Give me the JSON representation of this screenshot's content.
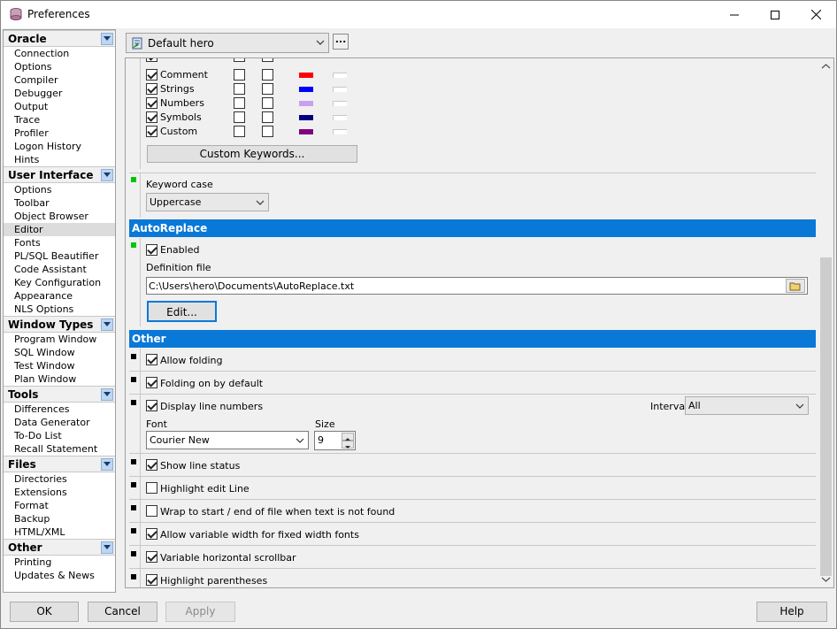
{
  "window": {
    "title": "Preferences"
  },
  "nav": [
    {
      "group": "Oracle",
      "items": [
        "Connection",
        "Options",
        "Compiler",
        "Debugger",
        "Output",
        "Trace",
        "Profiler",
        "Logon History",
        "Hints"
      ]
    },
    {
      "group": "User Interface",
      "items": [
        "Options",
        "Toolbar",
        "Object Browser",
        "Editor",
        "Fonts",
        "PL/SQL Beautifier",
        "Code Assistant",
        "Key Configuration",
        "Appearance",
        "NLS Options"
      ]
    },
    {
      "group": "Window Types",
      "items": [
        "Program Window",
        "SQL Window",
        "Test Window",
        "Plan Window"
      ]
    },
    {
      "group": "Tools",
      "items": [
        "Differences",
        "Data Generator",
        "To-Do List",
        "Recall Statement"
      ]
    },
    {
      "group": "Files",
      "items": [
        "Directories",
        "Extensions",
        "Format",
        "Backup",
        "HTML/XML"
      ]
    },
    {
      "group": "Other",
      "items": [
        "Printing",
        "Updates & News"
      ]
    }
  ],
  "selected_nav": "Editor",
  "profile": {
    "value": "Default hero",
    "more_label": "..."
  },
  "syntax_rows": [
    {
      "label": "Comment",
      "color": "#ff0000"
    },
    {
      "label": "Strings",
      "color": "#0000ff"
    },
    {
      "label": "Numbers",
      "color": "#c8a0f0"
    },
    {
      "label": "Symbols",
      "color": "#000080"
    },
    {
      "label": "Custom",
      "color": "#800080"
    }
  ],
  "custom_keywords_label": "Custom Keywords...",
  "keyword_case": {
    "label": "Keyword case",
    "value": "Uppercase"
  },
  "autoreplace": {
    "header": "AutoReplace",
    "enabled_label": "Enabled",
    "definition_label": "Definition file",
    "definition_value": "C:\\Users\\hero\\Documents\\AutoReplace.txt",
    "edit_label": "Edit..."
  },
  "other": {
    "header": "Other",
    "allow_folding": "Allow folding",
    "folding_default": "Folding on by default",
    "line_numbers": "Display line numbers",
    "interval_label": "Interval",
    "interval_value": "All",
    "font_label": "Font",
    "font_value": "Courier New",
    "size_label": "Size",
    "size_value": "9",
    "line_status": "Show line status",
    "highlight_edit": "Highlight edit Line",
    "wrap": "Wrap to start / end of file when text is not found",
    "var_width": "Allow variable width for fixed width fonts",
    "var_scroll": "Variable horizontal scrollbar",
    "highlight_paren": "Highlight parentheses"
  },
  "buttons": {
    "ok": "OK",
    "cancel": "Cancel",
    "apply": "Apply",
    "help": "Help"
  },
  "colors": {
    "accent": "#0a78d7",
    "indicator_green": "#00c800"
  }
}
